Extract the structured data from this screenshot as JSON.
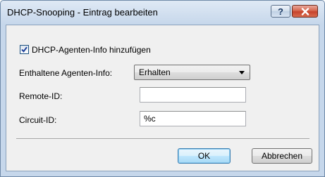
{
  "window": {
    "title": "DHCP-Snooping - Eintrag bearbeiten",
    "help_label": "?"
  },
  "form": {
    "checkbox": {
      "label": "DHCP-Agenten-Info hinzufügen",
      "checked": true
    },
    "agent_info": {
      "label": "Enthaltene Agenten-Info:",
      "selected": "Erhalten"
    },
    "remote_id": {
      "label": "Remote-ID:",
      "value": ""
    },
    "circuit_id": {
      "label": "Circuit-ID:",
      "value": "%c"
    }
  },
  "buttons": {
    "ok": "OK",
    "cancel": "Abbrechen"
  },
  "colors": {
    "close_button": "#c7432c",
    "title_bar": "#c9d9ec",
    "checkbox_check": "#1c3f9a"
  },
  "icons": {
    "close": "close-icon",
    "help": "help-icon",
    "check": "checkmark-icon",
    "dropdown": "chevron-down-icon"
  }
}
